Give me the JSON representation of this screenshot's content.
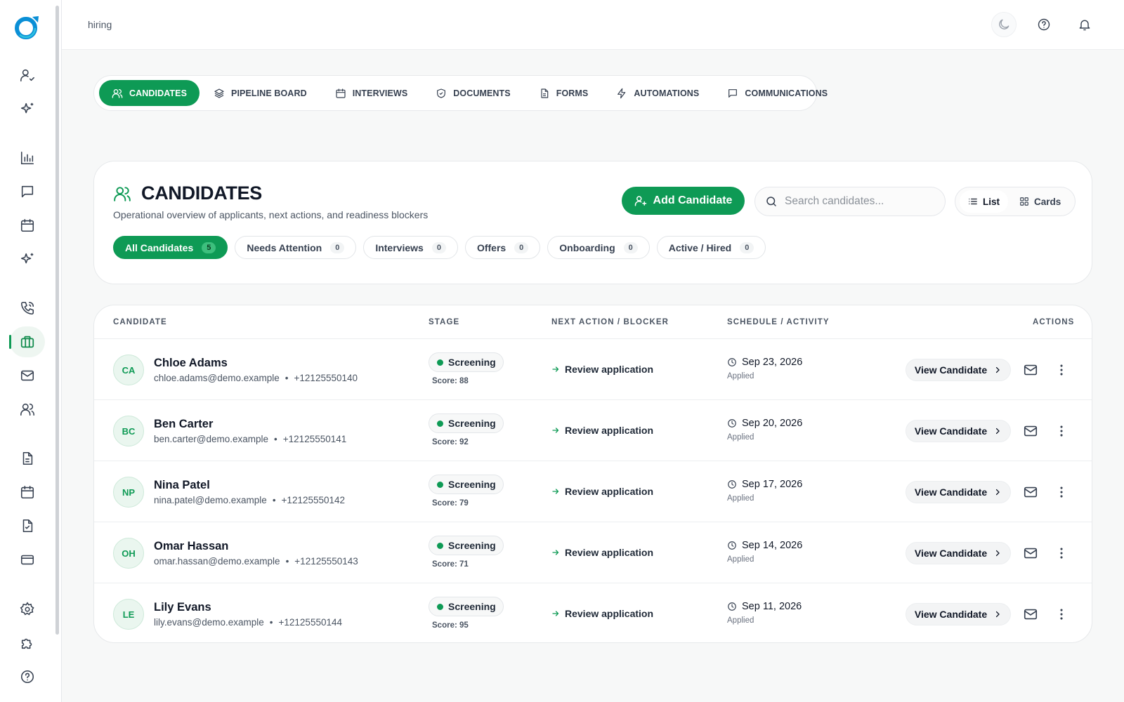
{
  "topbar": {
    "breadcrumb": "hiring"
  },
  "tabs": [
    {
      "label": "CANDIDATES",
      "icon": "users-icon",
      "active": true
    },
    {
      "label": "PIPELINE BOARD",
      "icon": "layers-icon",
      "active": false
    },
    {
      "label": "INTERVIEWS",
      "icon": "calendar-icon",
      "active": false
    },
    {
      "label": "DOCUMENTS",
      "icon": "shield-icon",
      "active": false
    },
    {
      "label": "FORMS",
      "icon": "file-text-icon",
      "active": false
    },
    {
      "label": "AUTOMATIONS",
      "icon": "zap-icon",
      "active": false
    },
    {
      "label": "COMMUNICATIONS",
      "icon": "message-square-icon",
      "active": false
    }
  ],
  "header": {
    "title": "CANDIDATES",
    "subtitle": "Operational overview of applicants, next actions, and readiness blockers",
    "add_label": "Add Candidate",
    "search_placeholder": "Search candidates...",
    "view_list": "List",
    "view_cards": "Cards"
  },
  "filters": [
    {
      "label": "All Candidates",
      "count": "5",
      "active": true
    },
    {
      "label": "Needs Attention",
      "count": "0",
      "active": false
    },
    {
      "label": "Interviews",
      "count": "0",
      "active": false
    },
    {
      "label": "Offers",
      "count": "0",
      "active": false
    },
    {
      "label": "Onboarding",
      "count": "0",
      "active": false
    },
    {
      "label": "Active / Hired",
      "count": "0",
      "active": false
    }
  ],
  "table": {
    "columns": {
      "candidate": "CANDIDATE",
      "stage": "STAGE",
      "next_action": "NEXT ACTION / BLOCKER",
      "schedule": "SCHEDULE / ACTIVITY",
      "actions": "ACTIONS"
    },
    "view_label": "View Candidate",
    "rows": [
      {
        "initials": "CA",
        "name": "Chloe Adams",
        "email": "chloe.adams@demo.example",
        "phone": "+12125550140",
        "stage": "Screening",
        "score": "Score: 88",
        "next_action": "Review application",
        "date": "Sep 23, 2026",
        "activity": "Applied"
      },
      {
        "initials": "BC",
        "name": "Ben Carter",
        "email": "ben.carter@demo.example",
        "phone": "+12125550141",
        "stage": "Screening",
        "score": "Score: 92",
        "next_action": "Review application",
        "date": "Sep 20, 2026",
        "activity": "Applied"
      },
      {
        "initials": "NP",
        "name": "Nina Patel",
        "email": "nina.patel@demo.example",
        "phone": "+12125550142",
        "stage": "Screening",
        "score": "Score: 79",
        "next_action": "Review application",
        "date": "Sep 17, 2026",
        "activity": "Applied"
      },
      {
        "initials": "OH",
        "name": "Omar Hassan",
        "email": "omar.hassan@demo.example",
        "phone": "+12125550143",
        "stage": "Screening",
        "score": "Score: 71",
        "next_action": "Review application",
        "date": "Sep 14, 2026",
        "activity": "Applied"
      },
      {
        "initials": "LE",
        "name": "Lily Evans",
        "email": "lily.evans@demo.example",
        "phone": "+12125550144",
        "stage": "Screening",
        "score": "Score: 95",
        "next_action": "Review application",
        "date": "Sep 11, 2026",
        "activity": "Applied"
      }
    ]
  },
  "colors": {
    "accent": "#0e9a55",
    "accent_light": "#eaf6ef"
  }
}
